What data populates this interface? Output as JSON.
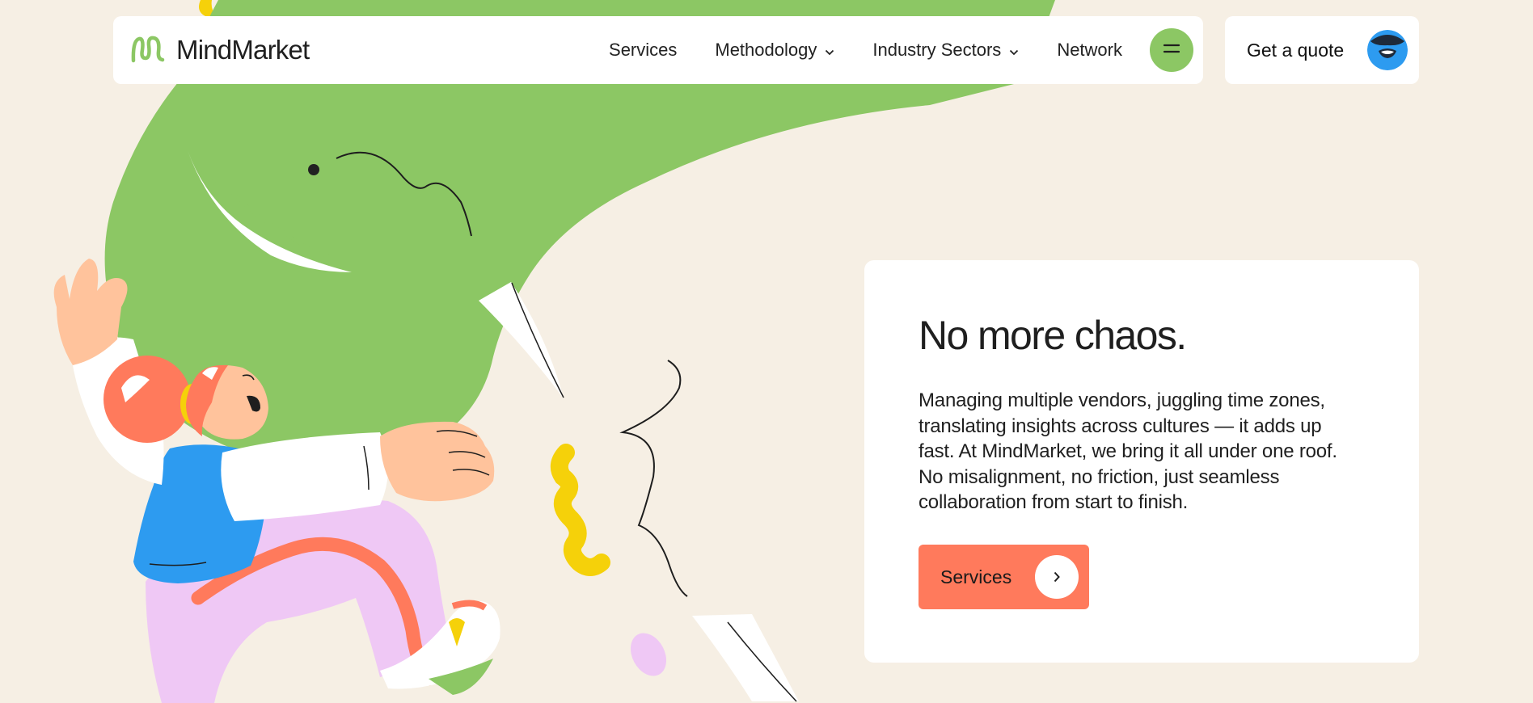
{
  "brand": {
    "name": "MindMarket",
    "logo_icon": "squiggle-logo-icon",
    "accent": "#8cc764"
  },
  "nav": {
    "items": [
      {
        "label": "Services",
        "has_dropdown": false
      },
      {
        "label": "Methodology",
        "has_dropdown": true
      },
      {
        "label": "Industry Sectors",
        "has_dropdown": true
      },
      {
        "label": "Network",
        "has_dropdown": false
      }
    ],
    "menu_icon": "menu-icon",
    "quote_label": "Get a quote",
    "quote_icon": "avatar-icon"
  },
  "hero": {
    "title": "No more chaos.",
    "body": "Managing multiple vendors, juggling time zones, translating insights across cultures — it adds up fast. At MindMarket, we bring it all under one roof. No misalignment, no friction, just seamless collaboration from start to finish.",
    "cta_label": "Services",
    "cta_icon": "chevron-right-icon",
    "cta_color": "#ff7a5c"
  },
  "colors": {
    "background": "#f6efe4",
    "green": "#8cc764",
    "blue": "#2d9bf0",
    "coral": "#ff7a5c",
    "yellow": "#f5d10a",
    "lilac": "#efc8f5",
    "skin": "#ffc39c"
  }
}
